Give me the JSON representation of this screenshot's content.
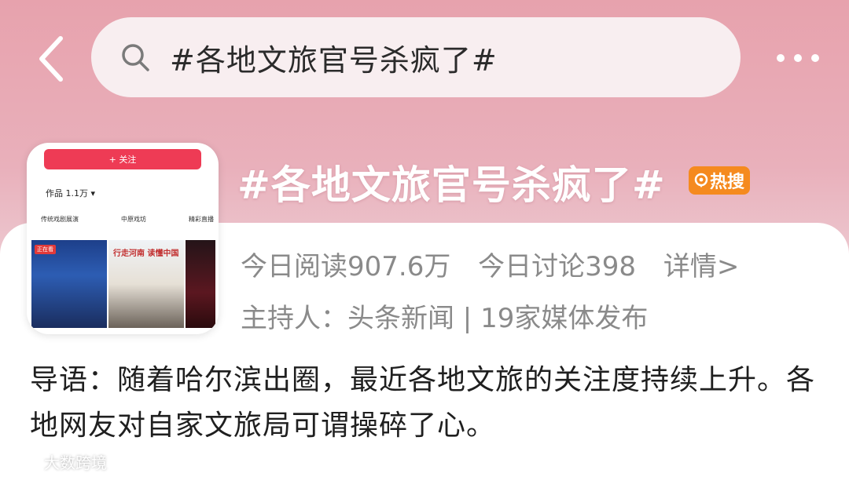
{
  "header": {
    "search_query": "#各地文旅官号杀疯了#"
  },
  "topic": {
    "title": "#各地文旅官号杀疯了#",
    "hot_badge": "热搜",
    "reads_today": "今日阅读907.6万",
    "discussions_today": "今日讨论398",
    "detail_link": "详情>",
    "host_line": "主持人：头条新闻 | 19家媒体发布",
    "intro": "导语：随着哈尔滨出圈，最近各地文旅的关注度持续上升。各地网友对自家文旅局可谓操碎了心。"
  },
  "thumbnail": {
    "follow_label": "+ 关注",
    "works_label": "作品 1.1万 ▾",
    "tabs": [
      "传统戏剧展演",
      "中原戏坊",
      "精彩直播"
    ],
    "tile1_tag": "正在看",
    "tile2_caption": "行走河南 读懂中国"
  },
  "watermark": {
    "text": "大数跨境"
  },
  "colors": {
    "accent_red": "#ee3b55",
    "hot_orange": "#f58a1f",
    "secondary_text": "#8a8a8a"
  },
  "icons": {
    "back": "chevron-left-icon",
    "search": "search-icon",
    "more": "more-horizontal-icon",
    "hot": "flame-icon"
  }
}
